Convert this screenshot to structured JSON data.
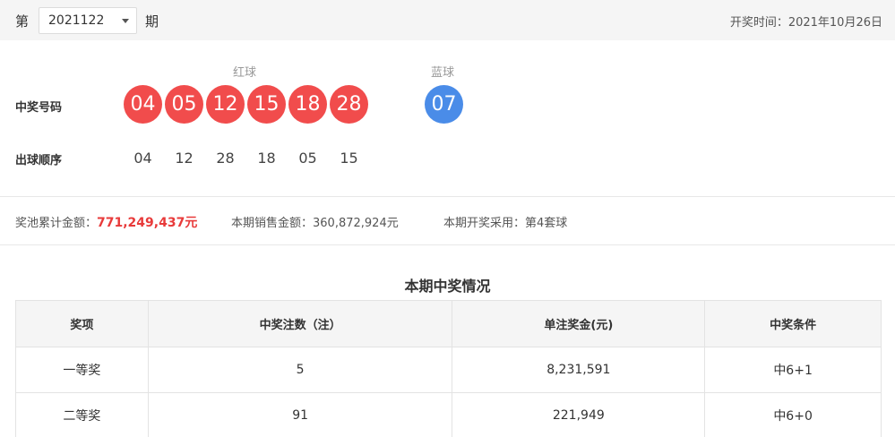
{
  "header": {
    "prefix": "第",
    "issue_value": "2021122",
    "suffix": "期",
    "draw_time": "开奖时间：2021年10月26日"
  },
  "balls": {
    "red_label": "红球",
    "blue_label": "蓝球",
    "winning_label": "中奖号码",
    "order_label": "出球顺序",
    "red": [
      "04",
      "05",
      "12",
      "15",
      "18",
      "28"
    ],
    "blue": [
      "07"
    ],
    "order": [
      "04",
      "12",
      "28",
      "18",
      "05",
      "15"
    ],
    "colors": {
      "red": "#f14c4c",
      "blue": "#4a8ce8"
    }
  },
  "stats": {
    "pool_label": "奖池累计金额：",
    "pool_value": "771,249,437元",
    "sales_label": "本期销售金额：",
    "sales_value": "360,872,924元",
    "machine_label": "本期开奖采用：",
    "machine_value": "第4套球"
  },
  "prize_table": {
    "title": "本期中奖情况",
    "headers": [
      "奖项",
      "中奖注数（注）",
      "单注奖金(元)",
      "中奖条件"
    ],
    "rows": [
      [
        "一等奖",
        "5",
        "8,231,591",
        "中6+1"
      ],
      [
        "二等奖",
        "91",
        "221,949",
        "中6+0"
      ]
    ]
  }
}
